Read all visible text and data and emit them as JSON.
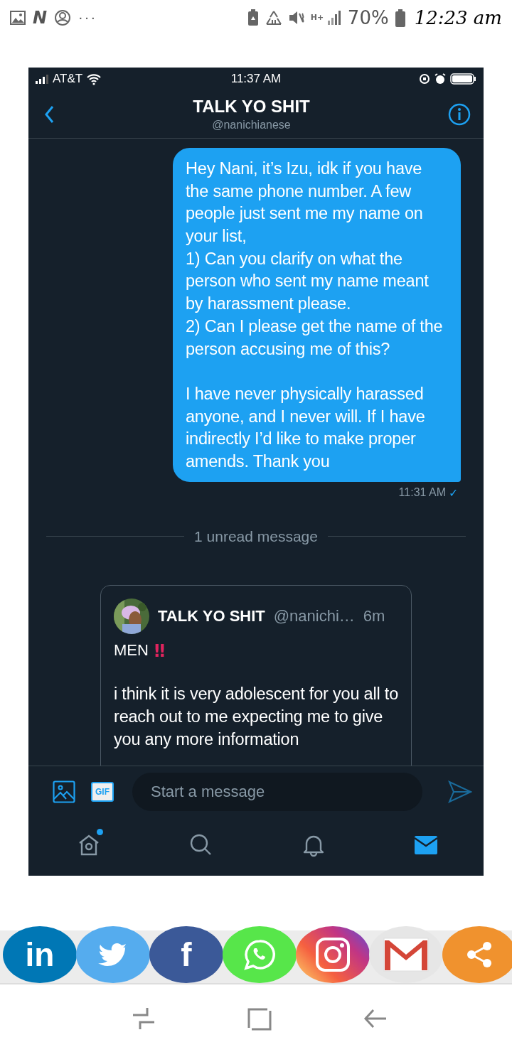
{
  "device_status_bar": {
    "app_letter": "N",
    "more": "···",
    "network": "H+",
    "battery": "70%",
    "time": "12:23 am"
  },
  "phone_status_bar": {
    "carrier": "AT&T",
    "time": "11:37 AM"
  },
  "header": {
    "title": "TALK YO SHIT",
    "handle": "@nanichianese"
  },
  "messages": [
    {
      "kind": "sent",
      "text": "Hey Nani, it’s Izu, idk if you have the same phone number. A few people just sent me my name on your list,\n1) Can you clarify on what the person who sent my name meant by harassment please.\n2) Can I please get the name of the person accusing me of this?\n\nI have never physically harassed anyone, and I never will. If I have indirectly I’d like to make proper amends. Thank you",
      "time": "11:31 AM",
      "status_mark": "✓"
    }
  ],
  "unread_divider": "1 unread message",
  "shared_tweet": {
    "name": "TALK YO SHIT",
    "handle": "@nanichi…",
    "age": "6m",
    "title": "MEN",
    "mark": "‼",
    "text": "i think it is very adolescent for you all to reach out to me expecting me to give you any more information"
  },
  "composer": {
    "gif": "GIF",
    "placeholder": "Start a message"
  },
  "tabs": [
    {
      "kind": "home",
      "selected": false,
      "badge": true
    },
    {
      "kind": "search",
      "selected": false,
      "badge": false
    },
    {
      "kind": "notifications",
      "selected": false,
      "badge": false
    },
    {
      "kind": "messages",
      "selected": true,
      "badge": false
    }
  ],
  "share_buttons": [
    {
      "kind": "linkedin",
      "label": "in"
    },
    {
      "kind": "twitter"
    },
    {
      "kind": "facebook",
      "label": "f"
    },
    {
      "kind": "whatsapp"
    },
    {
      "kind": "instagram"
    },
    {
      "kind": "gmail"
    },
    {
      "kind": "share"
    }
  ]
}
